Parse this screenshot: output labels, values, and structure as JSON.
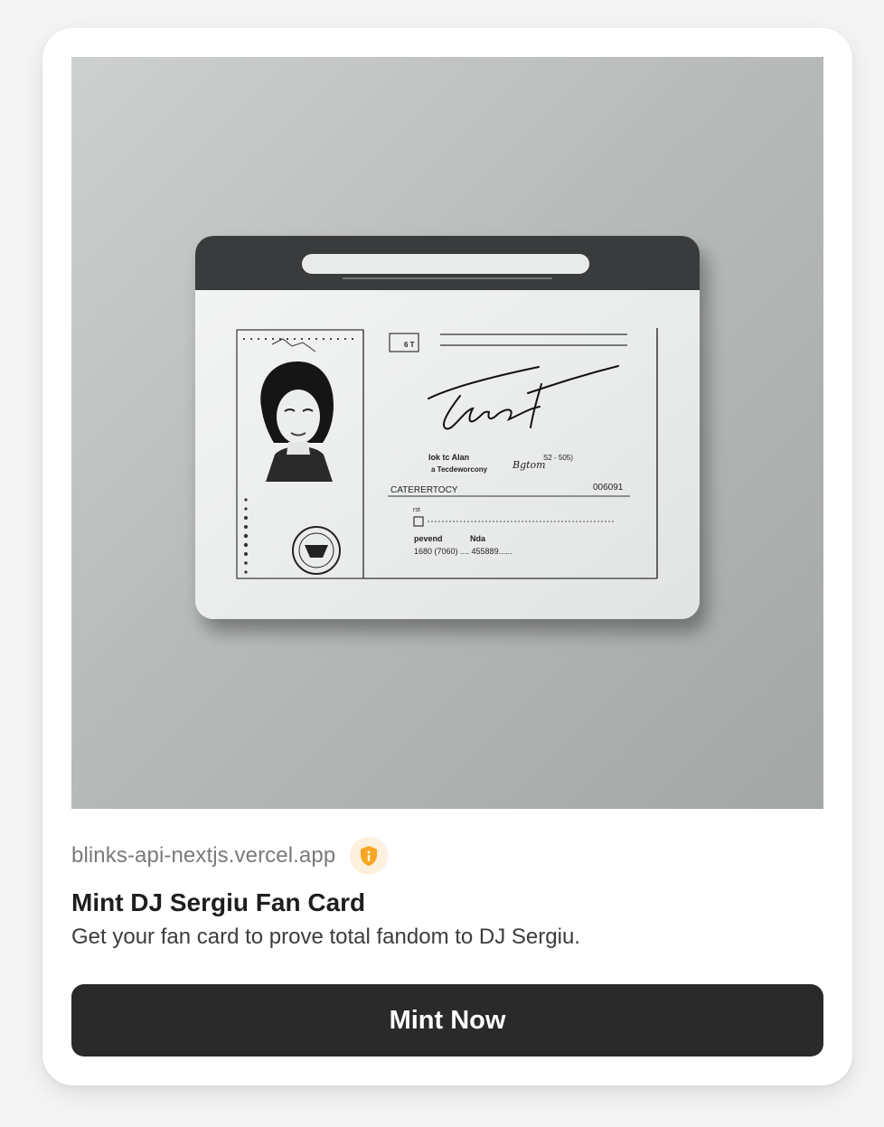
{
  "action": {
    "domain": "blinks-api-nextjs.vercel.app",
    "badge_icon": "shield-info-icon",
    "title": "Mint DJ Sergiu Fan Card",
    "description": "Get your fan card to prove total fandom to DJ Sergiu.",
    "button_label": "Mint Now"
  },
  "image": {
    "card_texts": {
      "box": "6 T",
      "row1": "Iok tc Alan",
      "row2": "a Tecdeworcony",
      "signature_note": "Bgtom",
      "code": "S2 - 505)",
      "category": "CATERERTOCY",
      "number": "006091",
      "small_label": "rst",
      "field1": "pevend",
      "field2": "Nda",
      "values": "1680 (7060) .... 455889......"
    }
  },
  "colors": {
    "button_bg": "#2a2a2a",
    "badge_bg": "#fdf0dc",
    "badge_icon": "#f5a623",
    "domain_text": "#7a7a7a"
  }
}
